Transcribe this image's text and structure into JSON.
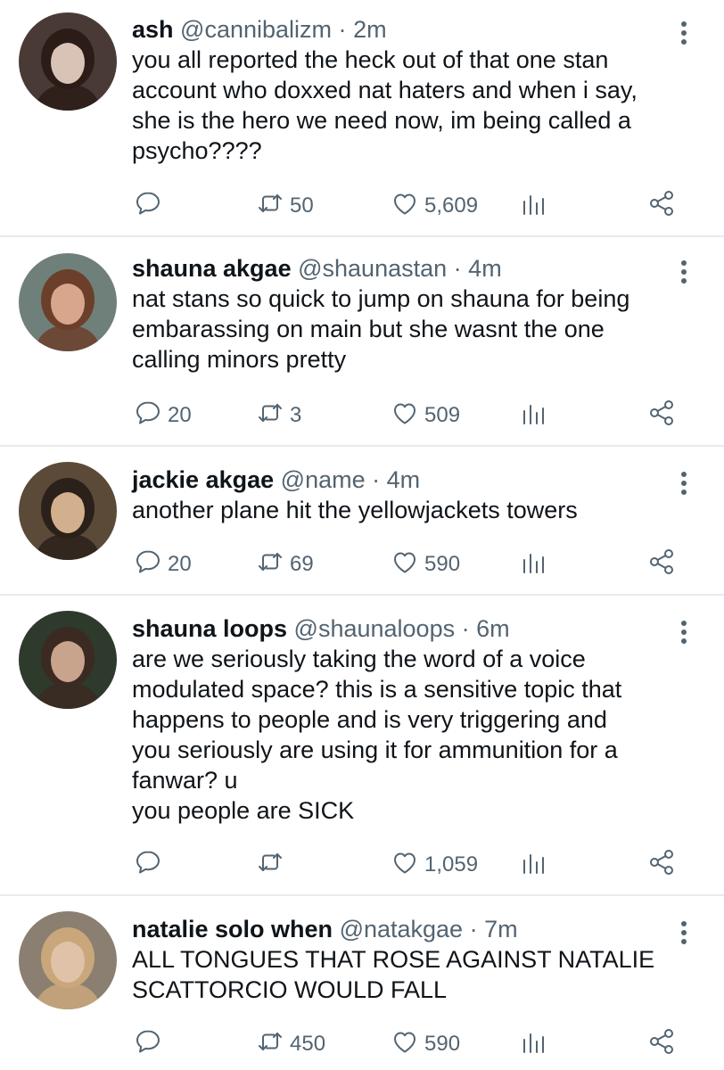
{
  "tweets": [
    {
      "name": "ash",
      "handle": "@cannibalizm",
      "dot": "·",
      "time": "2m",
      "text_lines": [
        "you all reported the heck out of that one stan",
        "account who doxxed nat haters and when i say,",
        "she is the hero we need now, im being called a",
        "psycho????"
      ],
      "replies": "",
      "retweets": "50",
      "likes": "5,609",
      "avatar_colors": {
        "bg": "#4a3a36",
        "skin": "#d9c3b6",
        "hair": "#2b1c18"
      }
    },
    {
      "name": "shauna akgae",
      "handle": "@shaunastan",
      "dot": "·",
      "time": "4m",
      "text_lines": [
        "nat stans so quick to jump on shauna for being",
        "embarassing on main but she wasnt the one",
        "calling minors pretty"
      ],
      "replies": "20",
      "retweets": "3",
      "likes": "509",
      "avatar_colors": {
        "bg": "#6f7f79",
        "skin": "#d7a68c",
        "hair": "#6b3f2a"
      }
    },
    {
      "name": "jackie akgae",
      "handle": "@name",
      "dot": "·",
      "time": "4m",
      "text_lines": [
        "another plane hit the yellowjackets towers"
      ],
      "replies": "20",
      "retweets": "69",
      "likes": "590",
      "avatar_colors": {
        "bg": "#5b4a38",
        "skin": "#d2b08e",
        "hair": "#2a211a"
      }
    },
    {
      "name": "shauna loops",
      "handle": "@shaunaloops",
      "dot": "·",
      "time": "6m",
      "text_lines": [
        "are we seriously taking the word of a voice",
        "modulated space? this is a sensitive topic that",
        "happens to people and is very triggering and",
        "you seriously are using it for ammunition for a",
        "fanwar? u",
        "you people are SICK"
      ],
      "replies": "",
      "retweets": "",
      "likes": "1,059",
      "avatar_colors": {
        "bg": "#2e3a2c",
        "skin": "#c9a48c",
        "hair": "#3a2a22"
      }
    },
    {
      "name": "natalie solo when",
      "handle": "@natakgae",
      "dot": "·",
      "time": "7m",
      "text_lines": [
        "ALL TONGUES THAT ROSE AGAINST NATALIE",
        "SCATTORCIO WOULD FALL"
      ],
      "replies": "",
      "retweets": "450",
      "likes": "590",
      "avatar_colors": {
        "bg": "#8a7f70",
        "skin": "#e0c2a8",
        "hair": "#c9a77a"
      }
    }
  ],
  "icons": {
    "reply": "reply-icon",
    "retweet": "retweet-icon",
    "like": "heart-icon",
    "stats": "stats-icon",
    "share": "share-icon",
    "more": "more-options-icon"
  },
  "colors": {
    "text": "#0f1419",
    "secondary": "#536471",
    "divider": "#e6ecf0"
  }
}
